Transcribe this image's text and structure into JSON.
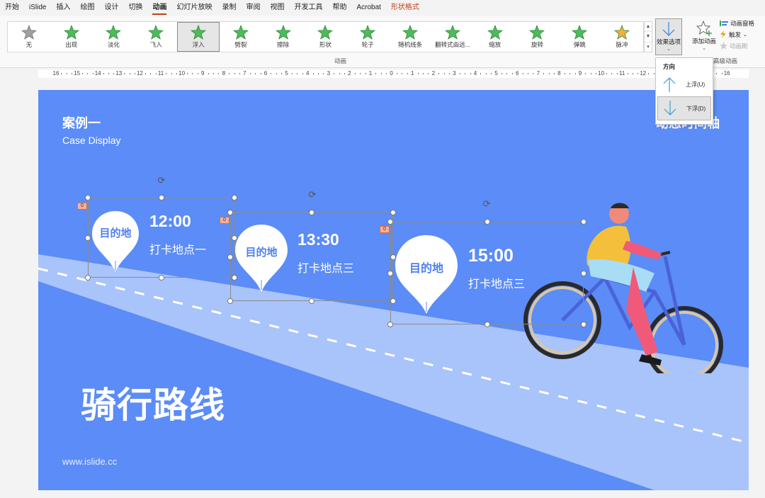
{
  "menu": {
    "items": [
      "开始",
      "iSlide",
      "插入",
      "绘图",
      "设计",
      "切换",
      "动画",
      "幻灯片放映",
      "录制",
      "审阅",
      "视图",
      "开发工具",
      "帮助",
      "Acrobat",
      "形状格式"
    ],
    "active": "动画",
    "contextual": "形状格式"
  },
  "ribbon": {
    "animations": [
      {
        "label": "无",
        "icon": "star-none-icon"
      },
      {
        "label": "出现",
        "icon": "star-appear-icon"
      },
      {
        "label": "淡化",
        "icon": "star-fade-icon"
      },
      {
        "label": "飞入",
        "icon": "star-flyin-icon"
      },
      {
        "label": "浮入",
        "icon": "star-floatin-icon",
        "selected": true
      },
      {
        "label": "劈裂",
        "icon": "star-split-icon"
      },
      {
        "label": "擦除",
        "icon": "star-wipe-icon"
      },
      {
        "label": "形状",
        "icon": "star-shape-icon"
      },
      {
        "label": "轮子",
        "icon": "star-wheel-icon"
      },
      {
        "label": "随机线条",
        "icon": "star-randombars-icon"
      },
      {
        "label": "翻转式由远...",
        "icon": "star-growturn-icon"
      },
      {
        "label": "缩放",
        "icon": "star-zoom-icon"
      },
      {
        "label": "旋转",
        "icon": "star-swivel-icon"
      },
      {
        "label": "弹跳",
        "icon": "star-bounce-icon"
      },
      {
        "label": "脉冲",
        "icon": "star-pulse-icon"
      }
    ],
    "group_label": "动画",
    "effect_options": "效果选项",
    "add_animation": "添加动画",
    "animation_pane": "动画窗格",
    "trigger": "触发",
    "animation_painter": "动画刷",
    "advanced_label": "高级动画"
  },
  "dropdown": {
    "title": "方向",
    "options": [
      {
        "label": "上浮(U)",
        "icon": "arrow-up-icon"
      },
      {
        "label": "下浮(D)",
        "icon": "arrow-down-icon",
        "selected": true
      }
    ]
  },
  "ruler": {
    "labels": [
      "16",
      "15",
      "14",
      "13",
      "12",
      "11",
      "10",
      "9",
      "8",
      "7",
      "6",
      "5",
      "4",
      "3",
      "2",
      "1",
      "0",
      "1",
      "2",
      "3",
      "4",
      "5",
      "6",
      "7",
      "8",
      "9",
      "10",
      "11",
      "12",
      "13",
      "14",
      "15",
      "16"
    ]
  },
  "slide": {
    "case_title": "案例一",
    "case_subtitle": "Case Display",
    "hidden_title": "动态时间轴",
    "main_title": "骑行路线",
    "url": "www.islide.cc",
    "background_color": "#5b8cf7",
    "road_color": "#a9c3fb",
    "stops": [
      {
        "pin_label": "目的地",
        "time": "12:00",
        "place": "打卡地点一",
        "anim_tag": "0"
      },
      {
        "pin_label": "目的地",
        "time": "13:30",
        "place": "打卡地点三",
        "anim_tag": "0"
      },
      {
        "pin_label": "目的地",
        "time": "15:00",
        "place": "打卡地点三",
        "anim_tag": "0"
      }
    ]
  }
}
